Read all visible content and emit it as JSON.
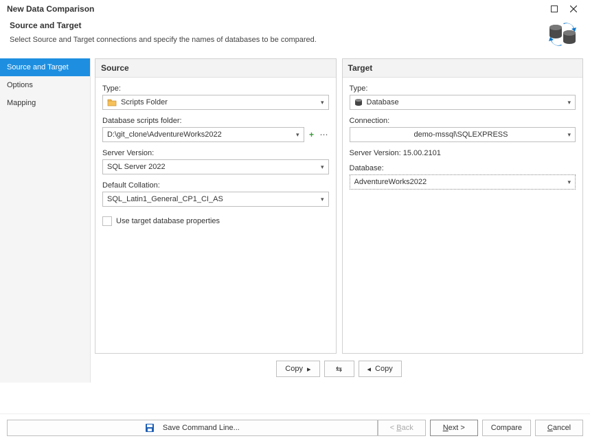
{
  "window": {
    "title": "New Data Comparison"
  },
  "header": {
    "title": "Source and Target",
    "description": "Select Source and Target connections and specify the names of databases to be compared."
  },
  "sidebar": {
    "items": [
      {
        "label": "Source and Target",
        "active": true
      },
      {
        "label": "Options",
        "active": false
      },
      {
        "label": "Mapping",
        "active": false
      }
    ]
  },
  "source": {
    "panel_title": "Source",
    "type_label": "Type:",
    "type_value": "Scripts Folder",
    "folder_label": "Database scripts folder:",
    "folder_value": "D:\\git_clone\\AdventureWorks2022",
    "server_version_label": "Server Version:",
    "server_version_value": "SQL Server 2022",
    "collation_label": "Default Collation:",
    "collation_value": "SQL_Latin1_General_CP1_CI_AS",
    "use_target_props_label": "Use target database properties",
    "use_target_props_checked": false
  },
  "target": {
    "panel_title": "Target",
    "type_label": "Type:",
    "type_value": "Database",
    "connection_label": "Connection:",
    "connection_value": "demo-mssql\\SQLEXPRESS",
    "server_version_label": "Server Version:",
    "server_version_value": "15.00.2101",
    "database_label": "Database:",
    "database_value": "AdventureWorks2022"
  },
  "copy_row": {
    "copy_right": "Copy",
    "copy_left": "Copy"
  },
  "footer": {
    "save_cmd": "Save Command Line...",
    "back": "< Back",
    "next": "Next >",
    "compare": "Compare",
    "cancel": "Cancel"
  }
}
